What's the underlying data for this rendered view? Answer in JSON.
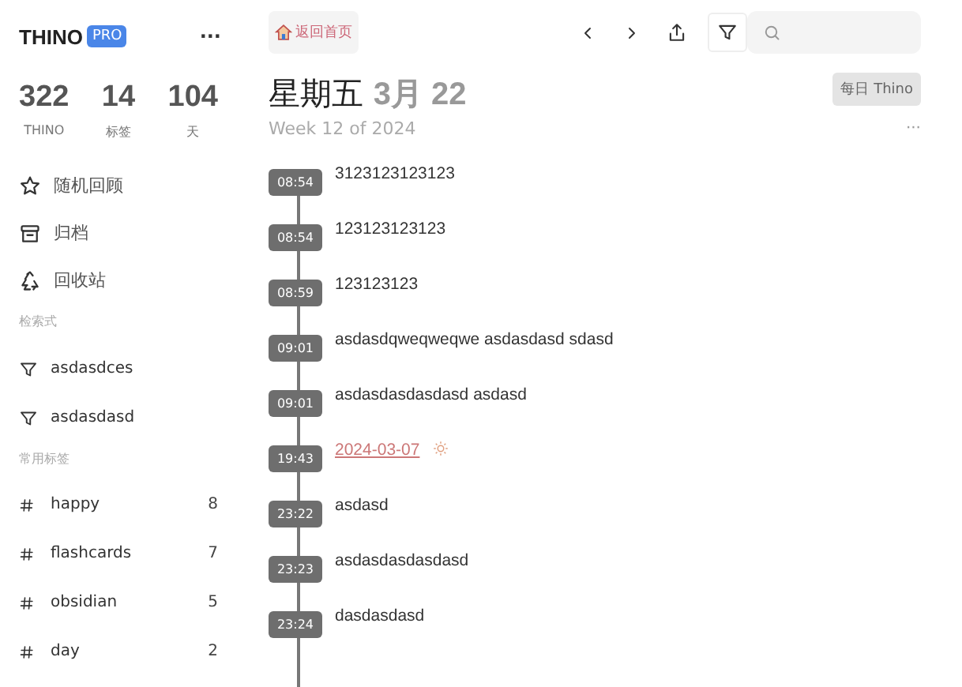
{
  "sidebar": {
    "brand": "THINO",
    "badge": "PRO",
    "menu": "···",
    "stats": [
      {
        "value": "322",
        "label": "THINO"
      },
      {
        "value": "14",
        "label": "标签"
      },
      {
        "value": "104",
        "label": "天"
      }
    ],
    "nav": [
      {
        "label": "随机回顾"
      },
      {
        "label": "归档"
      },
      {
        "label": "回收站"
      }
    ],
    "queries_title": "检索式",
    "queries": [
      {
        "label": "asdasdces"
      },
      {
        "label": "asdasdasd"
      }
    ],
    "tags_title": "常用标签",
    "tags": [
      {
        "label": "happy",
        "count": "8"
      },
      {
        "label": "flashcards",
        "count": "7"
      },
      {
        "label": "obsidian",
        "count": "5"
      },
      {
        "label": "day",
        "count": "2"
      }
    ]
  },
  "toolbar": {
    "home": "返回首页"
  },
  "header": {
    "weekday": "星期五",
    "date": "3月 22",
    "week": "Week 12 of 2024",
    "daily_button": "每日 Thino",
    "menu": "···"
  },
  "entries": [
    {
      "time": "08:54",
      "kind": "text",
      "text": "3123123123123"
    },
    {
      "time": "08:54",
      "kind": "text",
      "text": "123123123123"
    },
    {
      "time": "08:59",
      "kind": "text",
      "text": "123123123"
    },
    {
      "time": "09:01",
      "kind": "text",
      "text": "asdasdqweqweqwe asdasdasd sdasd"
    },
    {
      "time": "09:01",
      "kind": "text",
      "text": "asdasdasdasdasd asdasd"
    },
    {
      "time": "19:43",
      "kind": "link",
      "text": "2024-03-07"
    },
    {
      "time": "23:22",
      "kind": "text",
      "text": "asdasd"
    },
    {
      "time": "23:23",
      "kind": "text",
      "text": "asdasdasdasdasd"
    },
    {
      "time": "23:24",
      "kind": "text",
      "text": "dasdasdasd"
    }
  ]
}
